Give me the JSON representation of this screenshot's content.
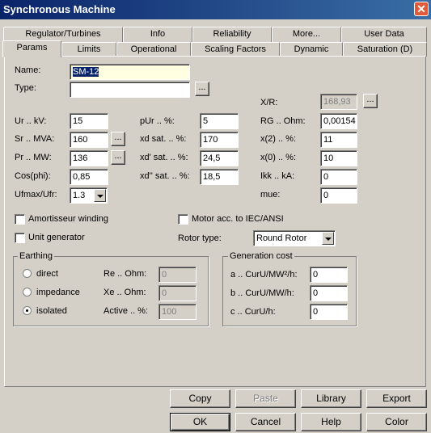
{
  "window": {
    "title": "Synchronous Machine",
    "close_icon": "close-icon"
  },
  "tabs_row1": [
    "Regulator/Turbines",
    "Info",
    "Reliability",
    "More...",
    "User Data"
  ],
  "tabs_row2": [
    "Params",
    "Limits",
    "Operational",
    "Scaling Factors",
    "Dynamic",
    "Saturation (D)"
  ],
  "active_tab": "Params",
  "fields": {
    "name": {
      "label": "Name:",
      "value": "SM-12"
    },
    "type": {
      "label": "Type:",
      "value": ""
    },
    "xr": {
      "label": "X/R:",
      "value": "168,93"
    },
    "ur": {
      "label": "Ur .. kV:",
      "value": "15"
    },
    "sr": {
      "label": "Sr .. MVA:",
      "value": "160"
    },
    "pr": {
      "label": "Pr .. MW:",
      "value": "136"
    },
    "cosphi": {
      "label": "Cos(phi):",
      "value": "0,85"
    },
    "ufmax": {
      "label": "Ufmax/Ufr:",
      "value": "1.3"
    },
    "pur": {
      "label": "pUr .. %:",
      "value": "5"
    },
    "xdsat": {
      "label": "xd sat. .. %:",
      "value": "170"
    },
    "xd1sat": {
      "label": "xd' sat. .. %:",
      "value": "24,5"
    },
    "xd2sat": {
      "label": "xd'' sat. .. %:",
      "value": "18,5"
    },
    "rg": {
      "label": "RG .. Ohm:",
      "value": "0,00154"
    },
    "x2": {
      "label": "x(2) .. %:",
      "value": "11"
    },
    "x0": {
      "label": "x(0) .. %:",
      "value": "10"
    },
    "ikk": {
      "label": "Ikk .. kA:",
      "value": "0"
    },
    "mue": {
      "label": "mue:",
      "value": "0"
    }
  },
  "browse_label": "...",
  "checkboxes": {
    "amortisseur": {
      "label": "Amortisseur winding",
      "checked": false
    },
    "motor": {
      "label": "Motor acc. to IEC/ANSI",
      "checked": false
    },
    "unitgen": {
      "label": "Unit generator",
      "checked": false
    }
  },
  "rotor_type": {
    "label": "Rotor type:",
    "value": "Round Rotor"
  },
  "earthing": {
    "title": "Earthing",
    "options": [
      {
        "label": "direct",
        "selected": false
      },
      {
        "label": "impedance",
        "selected": false
      },
      {
        "label": "isolated",
        "selected": true
      }
    ],
    "re": {
      "label": "Re .. Ohm:",
      "value": "0"
    },
    "xe": {
      "label": "Xe .. Ohm:",
      "value": "0"
    },
    "active": {
      "label": "Active .. %:",
      "value": "100"
    }
  },
  "generation_cost": {
    "title": "Generation cost",
    "a": {
      "label": "a .. CurU/MW²/h:",
      "value": "0"
    },
    "b": {
      "label": "b .. CurU/MW/h:",
      "value": "0"
    },
    "c": {
      "label": "c .. CurU/h:",
      "value": "0"
    }
  },
  "buttons": {
    "copy": "Copy",
    "paste": "Paste",
    "library": "Library",
    "export": "Export",
    "ok": "OK",
    "cancel": "Cancel",
    "help": "Help",
    "color": "Color"
  }
}
